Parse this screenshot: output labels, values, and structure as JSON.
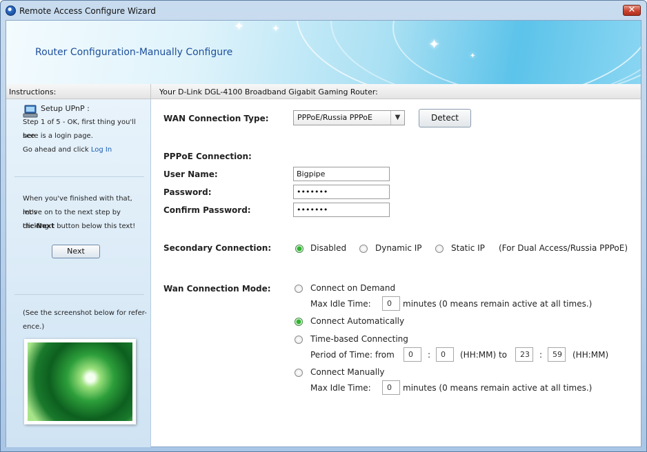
{
  "window": {
    "title": "Remote Access Configure Wizard",
    "close_glyph": "✕"
  },
  "banner": {
    "title": "Router Configuration-Manually Configure"
  },
  "left": {
    "header": "Instructions:",
    "step_title": "Setup UPnP :",
    "step_text_1": "Step 1 of 5 - OK, first thing you'll see",
    "step_text_2": "here is a login page.",
    "step_text_3": "Go ahead and click",
    "login_link": "Log In",
    "finish_1": "When you've finished with that, let's",
    "finish_2": "move on to the next step by clicking",
    "finish_3a": "the",
    "finish_3b": "Next",
    "finish_3c": "button below this text!",
    "next_button": "Next",
    "ref_1": "(See the screenshot below for refer-",
    "ref_2": "ence.)"
  },
  "right": {
    "header": "Your D-Link DGL-4100 Broadband Gigabit Gaming Router:",
    "wan_type_label": "WAN Connection Type:",
    "wan_type_value": "PPPoE/Russia PPPoE",
    "detect_button": "Detect",
    "pppoe_label": "PPPoE Connection:",
    "username_label": "User Name:",
    "username_value": "Bigpipe",
    "password_label": "Password:",
    "password_value": "•••••••",
    "confirm_label": "Confirm Password:",
    "confirm_value": "•••••••",
    "secondary_label": "Secondary Connection:",
    "secondary_options": [
      "Disabled",
      "Dynamic IP",
      "Static IP"
    ],
    "secondary_selected": "Disabled",
    "secondary_note": "(For Dual Access/Russia PPPoE)",
    "mode_label": "Wan Connection Mode:",
    "mode_options": [
      "Connect on Demand",
      "Connect Automatically",
      "Time-based Connecting",
      "Connect Manually"
    ],
    "mode_selected": "Connect Automatically",
    "max_idle_label": "Max Idle Time:",
    "idle_value_1": "0",
    "idle_note": "minutes (0 means remain active at all times.)",
    "period_label": "Period of Time: from",
    "from_h": "0",
    "from_m": "0",
    "hhmm_to": "(HH:MM) to",
    "to_h": "23",
    "to_m": "59",
    "hhmm": "(HH:MM)",
    "colon": ":",
    "idle_value_2": "0"
  },
  "icons": [
    "app-icon",
    "close-icon",
    "upnp-computer-icon",
    "chevron-down-icon"
  ]
}
